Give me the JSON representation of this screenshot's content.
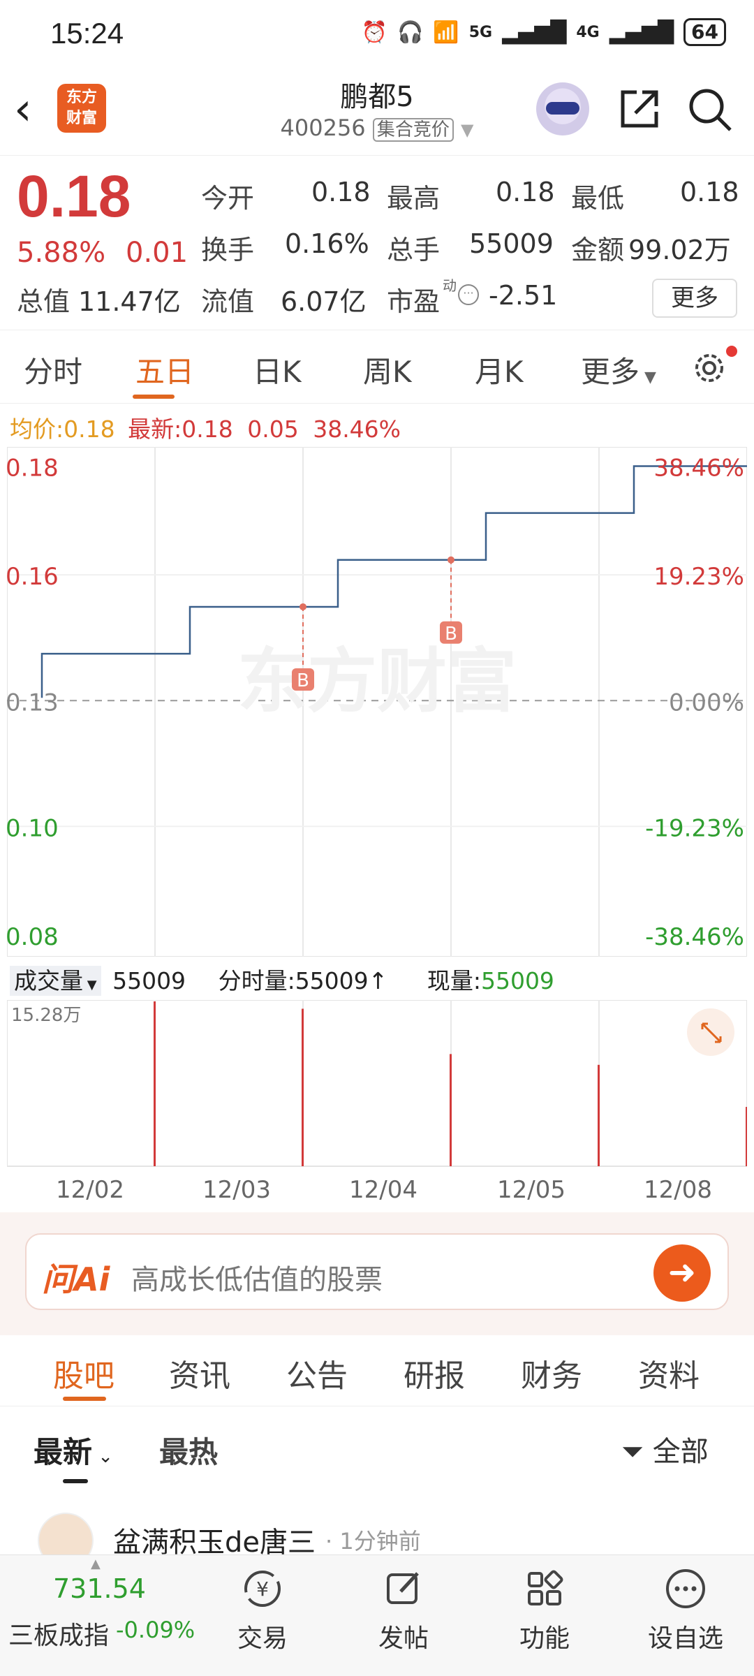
{
  "status_bar": {
    "time": "15:24",
    "battery": "64",
    "signal_1": "5G",
    "signal_2": "4G"
  },
  "header": {
    "logo_line1": "东方",
    "logo_line2": "财富",
    "stock_name": "鹏都5",
    "stock_code": "400256",
    "trade_mode": "集合竞价"
  },
  "quote": {
    "price": "0.18",
    "change_pct": "5.88%",
    "change_val": "0.01",
    "open_label": "今开",
    "open": "0.18",
    "high_label": "最高",
    "high": "0.18",
    "low_label": "最低",
    "low": "0.18",
    "turnover_label": "换手",
    "turnover": "0.16%",
    "volume_label": "总手",
    "volume": "55009",
    "amount_label": "金额",
    "amount": "99.02万",
    "mktcap_label": "总值",
    "mktcap": "11.47亿",
    "float_label": "流值",
    "float_cap": "6.07亿",
    "pe_label": "市盈",
    "pe_sup": "动",
    "pe": "-2.51",
    "more": "更多"
  },
  "tabs": [
    "分时",
    "五日",
    "日K",
    "周K",
    "月K",
    "更多"
  ],
  "active_tab": "五日",
  "avg_line": {
    "avg_label": "均价:",
    "avg": "0.18",
    "latest_label": "最新:",
    "latest": "0.18",
    "chg": "0.05",
    "chg_pct": "38.46%"
  },
  "colors": {
    "up": "#d23a3a",
    "down": "#2f9e2f",
    "accent": "#e0661f",
    "line": "#3a5f8a"
  },
  "chart_data": {
    "type": "line",
    "x": [
      "12/02",
      "12/03",
      "12/04",
      "12/05",
      "12/08"
    ],
    "y_left_ticks": [
      "0.18",
      "0.16",
      "0.13",
      "0.10",
      "0.08"
    ],
    "y_right_ticks": [
      "38.46%",
      "19.23%",
      "0.00%",
      "-19.23%",
      "-38.46%"
    ],
    "ylim": [
      0.08,
      0.18
    ],
    "base": 0.13,
    "series": [
      {
        "values": [
          0.14,
          0.15,
          0.16,
          0.17,
          0.18
        ]
      }
    ],
    "buy_marks": [
      {
        "day": "12/03",
        "label": "B"
      },
      {
        "day": "12/04",
        "label": "B"
      }
    ],
    "watermark": "东方财富",
    "volume": {
      "label": "成交量",
      "total": "55009",
      "period_label": "分时量:",
      "period": "55009",
      "current_label": "现量:",
      "current": "55009",
      "max_label": "15.28万",
      "values": [
        152800,
        146000,
        104000,
        94000,
        55009
      ]
    }
  },
  "ask_ai": {
    "logo": "问Ai",
    "placeholder": "高成长低估值的股票"
  },
  "sub_tabs": [
    "股吧",
    "资讯",
    "公告",
    "研报",
    "财务",
    "资料"
  ],
  "filters": {
    "latest": "最新",
    "hot": "最热",
    "all": "全部"
  },
  "post": {
    "user": "盆满积玉de唐三",
    "time": "· 1分钟前"
  },
  "bottom_nav": {
    "index_value": "731.54",
    "index_name": "三板成指",
    "index_change": "-0.09%",
    "items": [
      "交易",
      "发帖",
      "功能",
      "设自选"
    ]
  }
}
